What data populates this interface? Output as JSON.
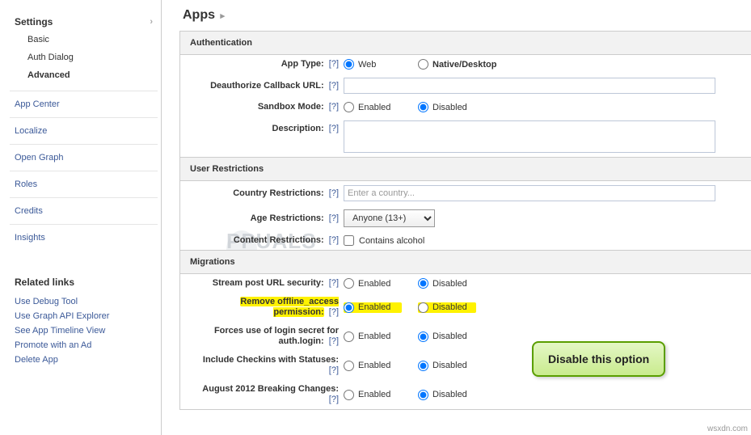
{
  "sidebar": {
    "settings": {
      "title": "Settings",
      "items": [
        "Basic",
        "Auth Dialog",
        "Advanced"
      ],
      "selected": 2
    },
    "links": [
      "App Center",
      "Localize",
      "Open Graph",
      "Roles",
      "Credits",
      "Insights"
    ],
    "related_title": "Related links",
    "related": [
      "Use Debug Tool",
      "Use Graph API Explorer",
      "See App Timeline View",
      "Promote with an Ad",
      "Delete App"
    ]
  },
  "page": {
    "title": "Apps"
  },
  "sections": {
    "auth": {
      "title": "Authentication",
      "app_type": {
        "label": "App Type:",
        "options": [
          "Web",
          "Native/Desktop"
        ],
        "value": "Web"
      },
      "deauth": {
        "label": "Deauthorize Callback URL:",
        "value": ""
      },
      "sandbox": {
        "label": "Sandbox Mode:",
        "options": [
          "Enabled",
          "Disabled"
        ],
        "value": "Disabled"
      },
      "description": {
        "label": "Description:",
        "value": ""
      }
    },
    "restrict": {
      "title": "User Restrictions",
      "country": {
        "label": "Country Restrictions:",
        "placeholder": "Enter a country..."
      },
      "age": {
        "label": "Age Restrictions:",
        "value": "Anyone (13+)"
      },
      "content": {
        "label": "Content Restrictions:",
        "check_label": "Contains alcohol"
      }
    },
    "migrations": {
      "title": "Migrations",
      "rows": [
        {
          "label": "Stream post URL security:",
          "value": "Disabled",
          "highlight": false
        },
        {
          "label": "Remove offline_access permission:",
          "value": "Enabled",
          "highlight": true
        },
        {
          "label": "Forces use of login secret for auth.login:",
          "value": "Disabled",
          "highlight": false
        },
        {
          "label": "Include Checkins with Statuses:",
          "value": "Disabled",
          "highlight": false
        },
        {
          "label": "August 2012 Breaking Changes:",
          "value": "Disabled",
          "highlight": false
        }
      ],
      "opt_enabled": "Enabled",
      "opt_disabled": "Disabled"
    }
  },
  "callout": "Disable this option",
  "watermark": "PPUALS",
  "footer": "wsxdn.com",
  "help": "[?]"
}
